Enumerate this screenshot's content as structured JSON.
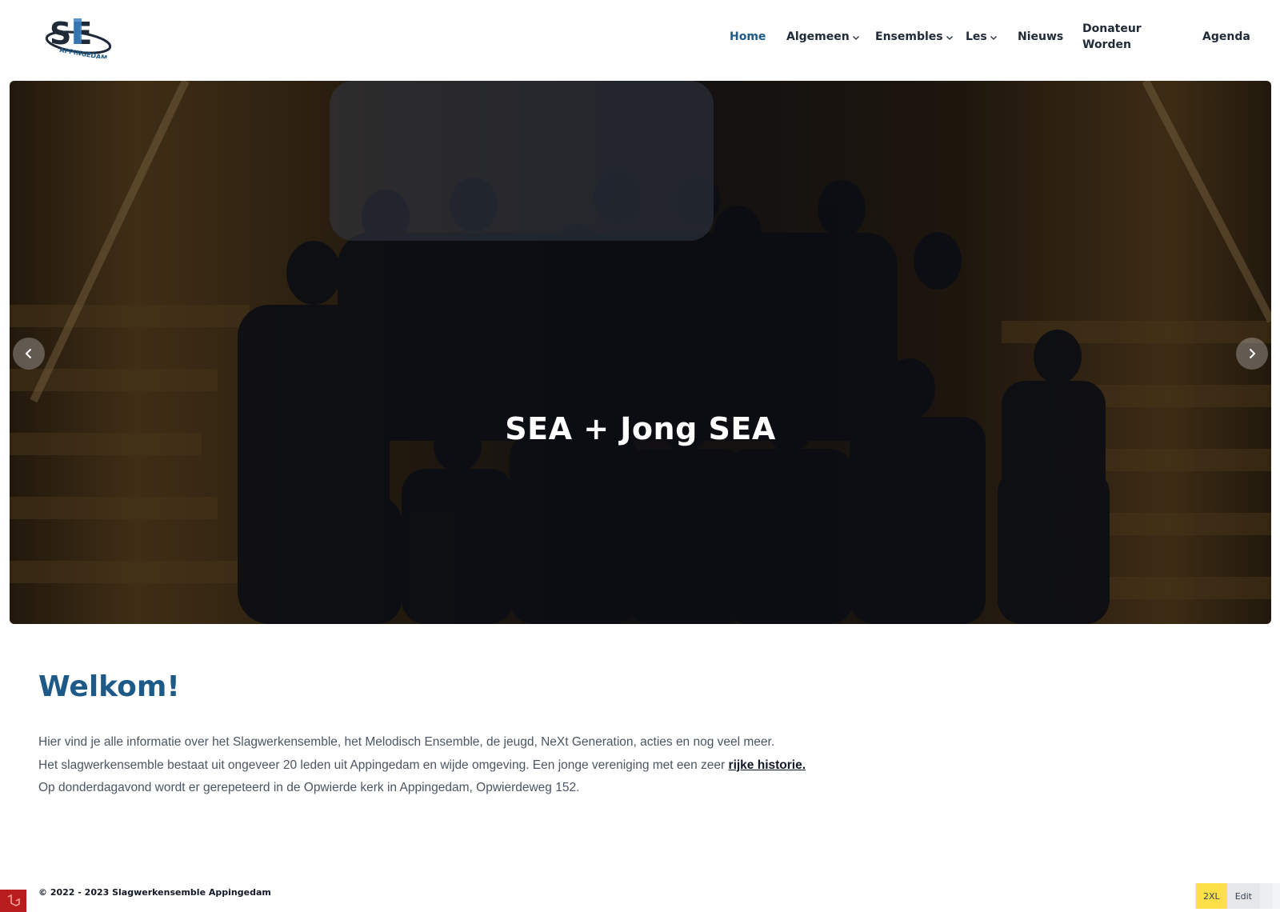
{
  "brand": {
    "logo_text": "SE",
    "logo_subtext": "APPINGEDAM",
    "colors": {
      "primary": "#1e5a88",
      "logo_blue": "#3b82c4",
      "logo_dark": "#1f2937"
    }
  },
  "nav": {
    "items": [
      {
        "label": "Home",
        "active": true,
        "dropdown": false
      },
      {
        "label": "Algemeen",
        "active": false,
        "dropdown": true
      },
      {
        "label": "Ensembles",
        "active": false,
        "dropdown": true
      },
      {
        "label": "Les",
        "active": false,
        "dropdown": true
      },
      {
        "label": "Nieuws",
        "active": false,
        "dropdown": false
      },
      {
        "label": "Donateur Worden",
        "active": false,
        "dropdown": false
      },
      {
        "label": "Agenda",
        "active": false,
        "dropdown": false
      }
    ]
  },
  "hero": {
    "caption": "SEA + Jong SEA",
    "prev_icon": "chevron-left-icon",
    "next_icon": "chevron-right-icon"
  },
  "welcome": {
    "title": "Welkom!",
    "line1": "Hier vind je alle informatie over het Slagwerkensemble, het Melodisch Ensemble, de jeugd, NeXt Generation, acties en nog veel meer.",
    "line2_prefix": "Het slagwerkensemble bestaat uit ongeveer 20 leden uit Appingedam en wijde omgeving. Een jonge vereniging met een zeer ",
    "line2_link": "rijke historie.",
    "line3": "Op donderdagavond wordt er gerepeteerd in de Opwierde kerk in Appingedam, Opwierdeweg 152."
  },
  "footer": {
    "copyright": "© 2022 - 2023 Slagwerkensemble Appingedam"
  },
  "dev_toolbar": {
    "breakpoint": "2XL",
    "edit_label": "Edit"
  }
}
